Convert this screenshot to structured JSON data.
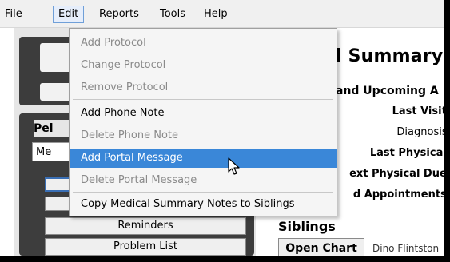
{
  "menubar": {
    "items": [
      {
        "label": "File"
      },
      {
        "label": "Edit"
      },
      {
        "label": "Reports"
      },
      {
        "label": "Tools"
      },
      {
        "label": "Help"
      }
    ],
    "active": "Edit"
  },
  "edit_menu": {
    "items": [
      {
        "label": "Add Protocol",
        "enabled": false
      },
      {
        "label": "Change Protocol",
        "enabled": false
      },
      {
        "label": "Remove Protocol",
        "enabled": false
      },
      {
        "label": "Add Phone Note",
        "enabled": true
      },
      {
        "label": "Delete Phone Note",
        "enabled": false
      },
      {
        "label": "Add Portal Message",
        "enabled": true,
        "highlighted": true
      },
      {
        "label": "Delete Portal Message",
        "enabled": false
      },
      {
        "label": "Copy Medical Summary Notes to Siblings",
        "enabled": true
      }
    ]
  },
  "left_panel": {
    "header": "Pel",
    "combo_value": "Me",
    "buttons": [
      {
        "label": "Reminders"
      },
      {
        "label": "Problem List"
      }
    ]
  },
  "summary": {
    "title": "l Summary",
    "section": "and Upcoming A",
    "fields": [
      {
        "label": "Last Visit:"
      },
      {
        "label": "Diagnosis:"
      },
      {
        "label": "Last Physical:"
      },
      {
        "label": "ext Physical Due:"
      },
      {
        "label": "d Appointments:"
      }
    ],
    "siblings_title": "Siblings",
    "open_chart_label": "Open Chart",
    "sibling_name": "Dino Flintston"
  },
  "colors": {
    "highlight": "#3a87d8",
    "disabled_text": "#8a8a8a",
    "panel_dark": "#3d3d3d"
  }
}
